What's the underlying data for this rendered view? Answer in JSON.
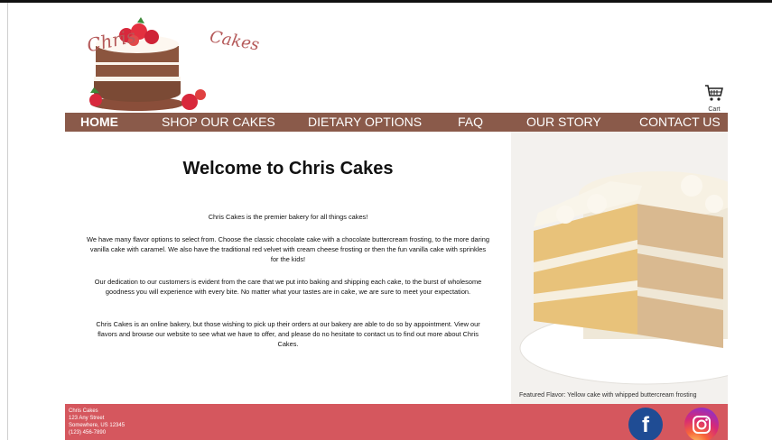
{
  "brand": {
    "logo_left": "Chris",
    "logo_right": "Cakes"
  },
  "cart": {
    "label": "Cart",
    "icon": "cart-icon"
  },
  "nav": {
    "items": [
      {
        "label": "HOME",
        "active": true
      },
      {
        "label": "SHOP OUR CAKES",
        "active": false
      },
      {
        "label": "DIETARY OPTIONS",
        "active": false
      },
      {
        "label": "FAQ",
        "active": false
      },
      {
        "label": "OUR STORY",
        "active": false
      },
      {
        "label": "CONTACT US",
        "active": false
      }
    ],
    "color": "#8a5a4a"
  },
  "main": {
    "title": "Welcome to Chris Cakes",
    "paragraphs": [
      "Chris Cakes is the premier bakery for all things cakes!",
      "We have many flavor options to select from. Choose the classic chocolate cake with a chocolate buttercream frosting, to the more daring vanilla cake with caramel. We also have the traditional red velvet with cream cheese frosting or then the fun vanilla cake with sprinkles for the kids!",
      "Our dedication to our customers is evident from the care that we put into baking and shipping each cake, to the burst of wholesome goodness you will experience with every bite. No matter what your tastes are in cake, we are sure to meet your expectation.",
      "Chris Cakes is an online bakery, but those wishing to pick up their orders at our bakery are able to do so by appointment. View our flavors and browse our website to see what we have to offer, and please do no hesitate to contact us to find out more about Chris Cakes."
    ]
  },
  "featured": {
    "caption": "Featured Flavor: Yellow cake with whipped buttercream frosting"
  },
  "footer": {
    "color": "#d5575e",
    "lines": [
      "Chris Cakes",
      "123 Any Street",
      "Somewhere, US 12345",
      "(123) 456-7890"
    ],
    "social": [
      {
        "name": "facebook",
        "icon": "facebook-icon",
        "glyph": "f"
      },
      {
        "name": "instagram",
        "icon": "instagram-icon"
      }
    ]
  }
}
